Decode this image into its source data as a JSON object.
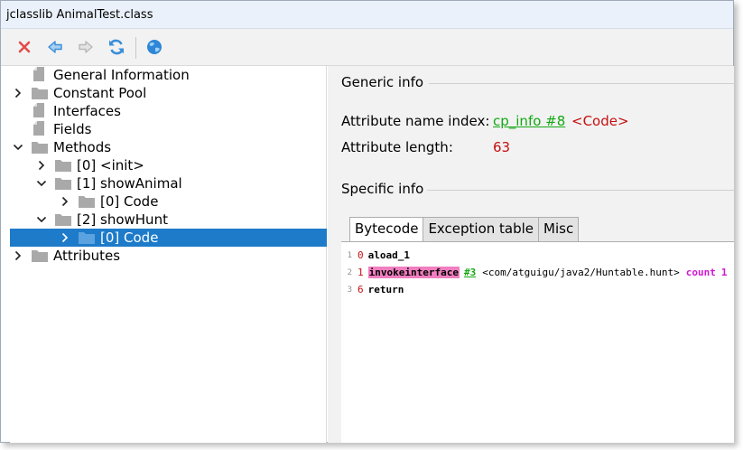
{
  "window": {
    "title": "jclasslib AnimalTest.class"
  },
  "toolbar": {
    "buttons": [
      {
        "name": "close-icon",
        "color": "#e34b4b"
      },
      {
        "name": "back-arrow-icon",
        "color": "#3a8ed8"
      },
      {
        "name": "forward-arrow-icon",
        "color": "#b8b8b8"
      },
      {
        "name": "reload-icon",
        "color": "#3a8ed8"
      },
      {
        "name": "web-globe-icon",
        "color": "#2e86d6"
      }
    ]
  },
  "tree": {
    "nodes": [
      {
        "label": "General Information",
        "icon": "file-icon"
      },
      {
        "label": "Constant Pool",
        "icon": "folder-icon",
        "state": "collapsed"
      },
      {
        "label": "Interfaces",
        "icon": "file-icon"
      },
      {
        "label": "Fields",
        "icon": "file-icon"
      },
      {
        "label": "Methods",
        "icon": "folder-icon",
        "state": "expanded"
      },
      {
        "label": "[0] <init>",
        "icon": "folder-icon",
        "state": "collapsed"
      },
      {
        "label": "[1] showAnimal",
        "icon": "folder-icon",
        "state": "expanded"
      },
      {
        "label": "[0] Code",
        "icon": "folder-icon",
        "state": "collapsed"
      },
      {
        "label": "[2] showHunt",
        "icon": "folder-icon",
        "state": "expanded"
      },
      {
        "label": "[0] Code",
        "icon": "folder-icon",
        "state": "collapsed",
        "selected": true
      },
      {
        "label": "Attributes",
        "icon": "folder-icon",
        "state": "collapsed"
      }
    ]
  },
  "generic": {
    "title": "Generic info",
    "name_index_label": "Attribute name index:",
    "name_index_link": "cp_info #8",
    "name_index_value": "<Code>",
    "length_label": "Attribute length:",
    "length_value": "63"
  },
  "specific": {
    "title": "Specific info"
  },
  "tabs": [
    {
      "label": "Bytecode",
      "active": true
    },
    {
      "label": "Exception table",
      "active": false
    },
    {
      "label": "Misc",
      "active": false
    }
  ],
  "bytecode": {
    "lines": [
      {
        "line": "1",
        "pc": "0",
        "instr": "aload_1"
      },
      {
        "line": "2",
        "pc": "1",
        "instr": "invokeinterface",
        "cpref": "#3",
        "cls": "<com/atguigu/java2/Huntable.hunt>",
        "kw": "count",
        "num": "1"
      },
      {
        "line": "3",
        "pc": "6",
        "instr": "return"
      }
    ]
  },
  "colors": {
    "selection": "#1d7bc9",
    "link": "#14a814",
    "value": "#c41010",
    "highlight": "#f07ec0",
    "keyword": "#d216d2"
  }
}
